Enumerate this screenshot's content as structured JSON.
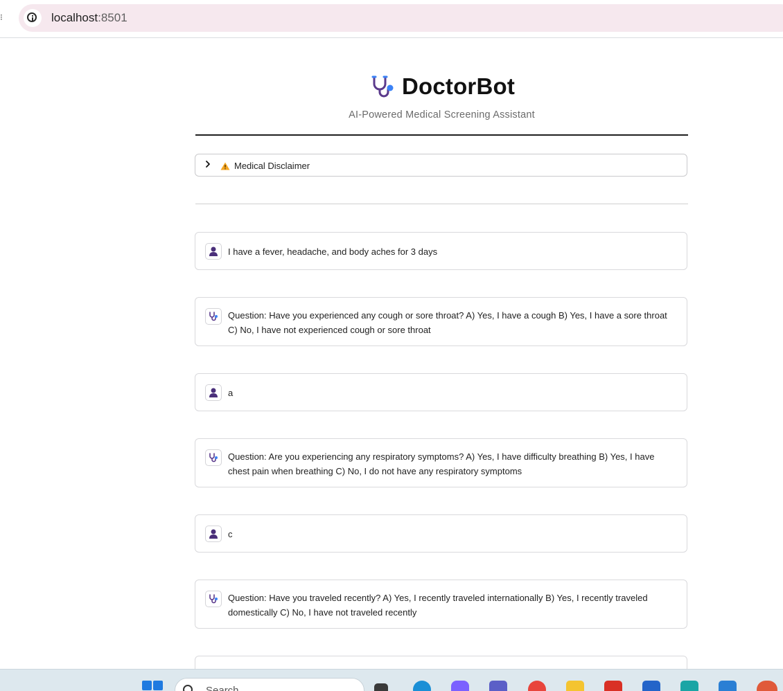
{
  "browser": {
    "url_host": "localhost",
    "url_port": ":8501",
    "info_icon": "info-icon"
  },
  "header": {
    "title": "DoctorBot",
    "subtitle": "AI-Powered Medical Screening Assistant",
    "logo_icon": "stethoscope-icon"
  },
  "disclaimer": {
    "label": "Medical Disclaimer",
    "expanded": false,
    "icon": "warning-icon"
  },
  "messages": [
    {
      "role": "user",
      "avatar": "user-icon",
      "text": "I have a fever, headache, and body aches for 3 days"
    },
    {
      "role": "assistant",
      "avatar": "stethoscope-icon",
      "text": "Question: Have you experienced any cough or sore throat? A) Yes, I have a cough B) Yes, I have a sore throat C) No, I have not experienced cough or sore throat"
    },
    {
      "role": "user",
      "avatar": "user-icon",
      "text": "a"
    },
    {
      "role": "assistant",
      "avatar": "stethoscope-icon",
      "text": "Question: Are you experiencing any respiratory symptoms? A) Yes, I have difficulty breathing B) Yes, I have chest pain when breathing C) No, I do not have any respiratory symptoms"
    },
    {
      "role": "user",
      "avatar": "user-icon",
      "text": "c"
    },
    {
      "role": "assistant",
      "avatar": "stethoscope-icon",
      "text": "Question: Have you traveled recently? A) Yes, I recently traveled internationally B) Yes, I recently traveled domestically C) No, I have not traveled recently"
    }
  ],
  "taskbar": {
    "search_placeholder": "Search",
    "icons": [
      "windows-start-icon",
      "task-view-icon",
      "edge-icon",
      "copilot-icon",
      "teams-icon",
      "chrome-icon",
      "file-explorer-icon",
      "gmail-icon",
      "store-icon",
      "app-icon",
      "vscode-icon",
      "chrome-profile-icon"
    ]
  },
  "colors": {
    "accent_purple": "#5b3a8c",
    "accent_blue": "#3b82f6",
    "address_bar": "#f6e8ee"
  }
}
